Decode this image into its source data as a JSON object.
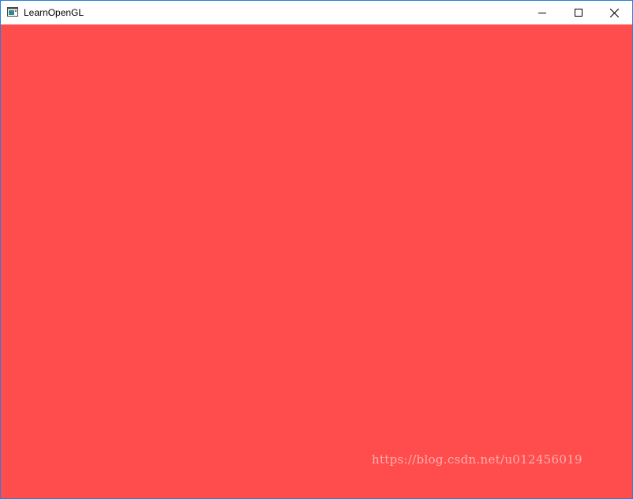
{
  "window": {
    "title": "LearnOpenGL",
    "app_icon": "console-window-icon",
    "controls": {
      "minimize_icon": "minimize-icon",
      "maximize_icon": "maximize-icon",
      "close_icon": "close-icon"
    }
  },
  "canvas": {
    "clear_color": "#ff4c4c"
  },
  "watermark": {
    "text": "https://blog.csdn.net/u012456019"
  },
  "colors": {
    "window_border": "#2b7fd6",
    "titlebar_bg": "#ffffff"
  }
}
